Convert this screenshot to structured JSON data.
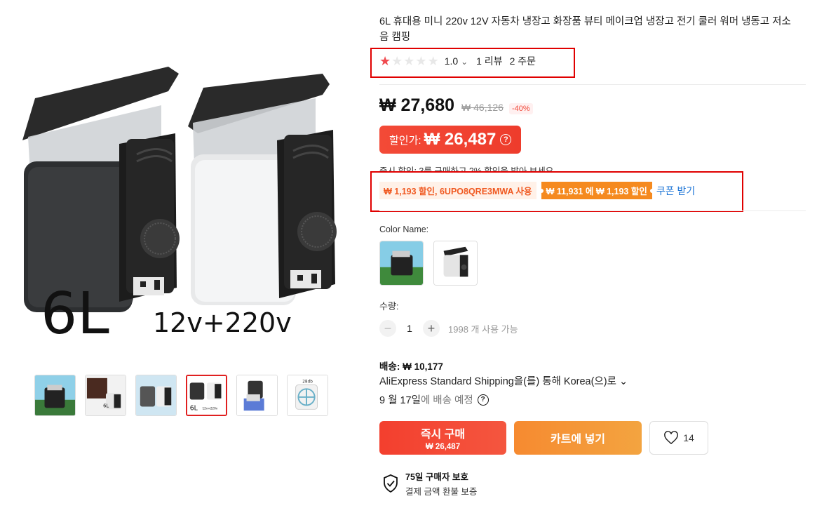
{
  "product": {
    "title": "6L 휴대용 미니 220v 12V 자동차 냉장고 화장품 뷰티 메이크업 냉장고 전기 쿨러 워머 냉동고 저소음 캠핑",
    "image_caption_big": "6L",
    "image_caption_small": "12v+220v"
  },
  "rating": {
    "stars_filled": 1,
    "stars_total": 5,
    "score": "1.0",
    "chevron": "⌄",
    "reviews": "1 리뷰",
    "orders": "2 주문"
  },
  "price": {
    "current": "₩ 27,680",
    "original": "₩ 46,126",
    "discount": "-40%",
    "sale_label": "할인가:",
    "sale_amount": "₩ 26,487",
    "sale_help": "?"
  },
  "instant_discount": "즉시 할인: 3를 구매하고 2% 할인을 받아 보세요 ⌄",
  "coupons": {
    "code_chip": "₩ 1,193 할인, 6UPO8QRE3MWA 사용",
    "threshold_chip": "₩ 11,931 에 ₩ 1,193 할인",
    "get_coupon": "쿠폰 받기"
  },
  "color": {
    "label": "Color Name:",
    "options": [
      "green-scene",
      "white-fridge"
    ]
  },
  "quantity": {
    "label": "수량:",
    "value": "1",
    "minus": "−",
    "plus": "+",
    "available": "1998 개 사용 가능"
  },
  "shipping": {
    "label": "배송:",
    "price": "₩ 10,177",
    "method": "AliExpress Standard Shipping을(를) 통해 Korea(으)로 ⌄",
    "date": "9 월 17일",
    "date_suffix": "에 배송 예정",
    "help": "?"
  },
  "actions": {
    "buy_now": "즉시 구매",
    "buy_now_price": "₩ 26,487",
    "add_to_cart": "카트에 넣기",
    "wishlist_count": "14"
  },
  "protection": {
    "title": "75일 구매자 보호",
    "subtitle": "결제 금액 환불 보증"
  },
  "gallery": {
    "thumbnails": [
      "thumb-1",
      "thumb-2",
      "thumb-3",
      "thumb-4",
      "thumb-5",
      "thumb-6"
    ],
    "thumb2_label": "6L",
    "thumb4_label": "6L",
    "thumb4_sub": "12v+220v",
    "thumb6_label": "28db"
  },
  "colors": {
    "accent_red": "#f04a3a",
    "accent_orange": "#f58a1f",
    "link_blue": "#1a73d6",
    "annotation_red": "#e00000"
  }
}
